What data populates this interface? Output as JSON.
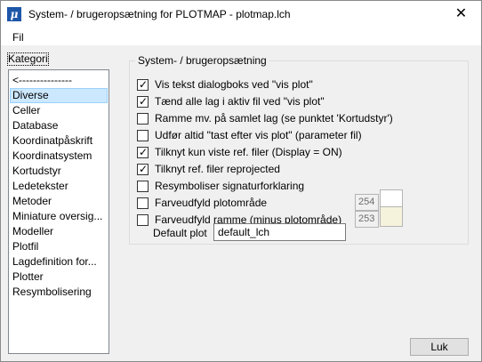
{
  "window": {
    "title": "System- / brugeropsætning for PLOTMAP - plotmap.lch",
    "close_glyph": "✕",
    "app_icon_glyph": "μ"
  },
  "menu": {
    "file_label": "Fil"
  },
  "sidebar": {
    "label": "Kategori",
    "items": [
      {
        "label": "<---------------",
        "selected": false
      },
      {
        "label": "Diverse",
        "selected": true
      },
      {
        "label": "Celler",
        "selected": false
      },
      {
        "label": "Database",
        "selected": false
      },
      {
        "label": "Koordinatpåskrift",
        "selected": false
      },
      {
        "label": "Koordinatsystem",
        "selected": false
      },
      {
        "label": "Kortudstyr",
        "selected": false
      },
      {
        "label": "Ledetekster",
        "selected": false
      },
      {
        "label": "Metoder",
        "selected": false
      },
      {
        "label": "Miniature oversig...",
        "selected": false
      },
      {
        "label": "Modeller",
        "selected": false
      },
      {
        "label": "Plotfil",
        "selected": false
      },
      {
        "label": "Lagdefinition for...",
        "selected": false
      },
      {
        "label": "Plotter",
        "selected": false
      },
      {
        "label": "Resymbolisering",
        "selected": false
      }
    ]
  },
  "settings": {
    "group_title": "System- / brugeropsætning",
    "checkmark_glyph": "✓",
    "options": [
      {
        "label": "Vis tekst dialogboks ved \"vis plot\"",
        "checked": true
      },
      {
        "label": "Tænd alle lag i aktiv fil ved \"vis plot\"",
        "checked": true
      },
      {
        "label": "Ramme mv. på samlet lag (se punktet 'Kortudstyr')",
        "checked": false
      },
      {
        "label": "Udfør altid \"tast efter vis plot\" (parameter fil)",
        "checked": false
      },
      {
        "label": "Tilknyt kun viste ref. filer (Display = ON)",
        "checked": true
      },
      {
        "label": "Tilknyt ref. filer reprojected",
        "checked": true
      },
      {
        "label": "Resymboliser signaturforklaring",
        "checked": false
      },
      {
        "label": "Farveudfyld plotområde",
        "checked": false,
        "color_value": "254",
        "swatch_color": "#ffffff"
      },
      {
        "label": "Farveudfyld ramme (minus plotområde)",
        "checked": false,
        "color_value": "253",
        "swatch_color": "#f6f3dd"
      }
    ],
    "default_plot_label": "Default plot",
    "default_plot_value": "default_lch"
  },
  "footer": {
    "ok_label": "Luk"
  }
}
